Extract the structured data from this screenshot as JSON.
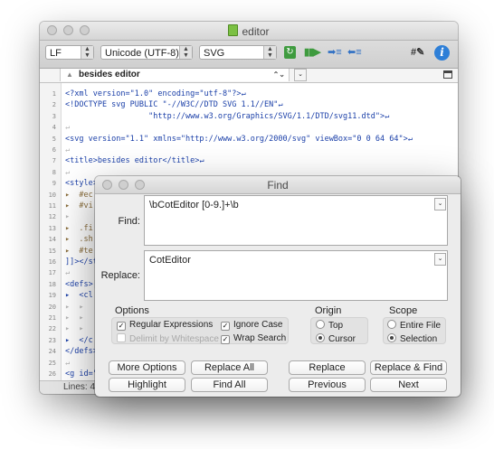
{
  "editor": {
    "title": "editor",
    "toolbar": {
      "line_ending": "LF",
      "encoding": "Unicode (UTF-8)",
      "syntax": "SVG"
    },
    "navigation": {
      "current": "besides editor"
    },
    "lines": [
      {
        "n": "1",
        "text": "<?xml version=\"1.0\" encoding=\"utf-8\"?>↵",
        "kind": "markup"
      },
      {
        "n": "2",
        "text": "<!DOCTYPE svg PUBLIC \"-//W3C//DTD SVG 1.1//EN\"↵",
        "kind": "markup"
      },
      {
        "n": "3",
        "text": "                  \"http://www.w3.org/Graphics/SVG/1.1/DTD/svg11.dtd\">↵",
        "kind": "markup"
      },
      {
        "n": "4",
        "text": "↵",
        "kind": "inv"
      },
      {
        "n": "5",
        "text": "<svg version=\"1.1\" xmlns=\"http://www.w3.org/2000/svg\" viewBox=\"0 0 64 64\">↵",
        "kind": "markup"
      },
      {
        "n": "6",
        "text": "↵",
        "kind": "inv"
      },
      {
        "n": "7",
        "text": "<title>besides editor</title>↵",
        "kind": "markup"
      },
      {
        "n": "8",
        "text": "↵",
        "kind": "inv"
      },
      {
        "n": "9",
        "text": "<style><![CDATA[↵",
        "kind": "markup"
      },
      {
        "n": "10",
        "text": "▸  #ec",
        "kind": "comment"
      },
      {
        "n": "11",
        "text": "▸  #vi",
        "kind": "comment"
      },
      {
        "n": "12",
        "text": "▸",
        "kind": "inv"
      },
      {
        "n": "13",
        "text": "▸  .fi",
        "kind": "comment"
      },
      {
        "n": "14",
        "text": "▸  .sh",
        "kind": "comment"
      },
      {
        "n": "15",
        "text": "▸  #te",
        "kind": "comment"
      },
      {
        "n": "16",
        "text": "]]></st",
        "kind": "markup"
      },
      {
        "n": "17",
        "text": "↵",
        "kind": "inv"
      },
      {
        "n": "18",
        "text": "<defs>|",
        "kind": "markup"
      },
      {
        "n": "19",
        "text": "▸  <cl",
        "kind": "markup"
      },
      {
        "n": "20",
        "text": "▸  ▸",
        "kind": "inv"
      },
      {
        "n": "21",
        "text": "▸  ▸",
        "kind": "inv"
      },
      {
        "n": "22",
        "text": "▸  ▸",
        "kind": "inv"
      },
      {
        "n": "23",
        "text": "▸  </c",
        "kind": "markup"
      },
      {
        "n": "24",
        "text": "</defs>",
        "kind": "markup"
      },
      {
        "n": "25",
        "text": "↵",
        "kind": "inv"
      },
      {
        "n": "26",
        "text": "<g id=\"",
        "kind": "markup"
      }
    ],
    "status": "Lines: 48"
  },
  "find": {
    "title": "Find",
    "find_label": "Find:",
    "find_value": "\\bCotEditor [0-9.]+\\b",
    "replace_label": "Replace:",
    "replace_value": "CotEditor",
    "options": {
      "title": "Options",
      "regular_expressions": "Regular Expressions",
      "ignore_case": "Ignore Case",
      "delimit_by_whitespace": "Delimit by Whitespace",
      "wrap_search": "Wrap Search"
    },
    "origin": {
      "title": "Origin",
      "top": "Top",
      "cursor": "Cursor"
    },
    "scope": {
      "title": "Scope",
      "entire_file": "Entire File",
      "selection": "Selection"
    },
    "buttons": {
      "more_options": "More Options",
      "replace_all": "Replace All",
      "replace": "Replace",
      "replace_and_find": "Replace & Find",
      "highlight": "Highlight",
      "find_all": "Find All",
      "previous": "Previous",
      "next": "Next"
    }
  }
}
